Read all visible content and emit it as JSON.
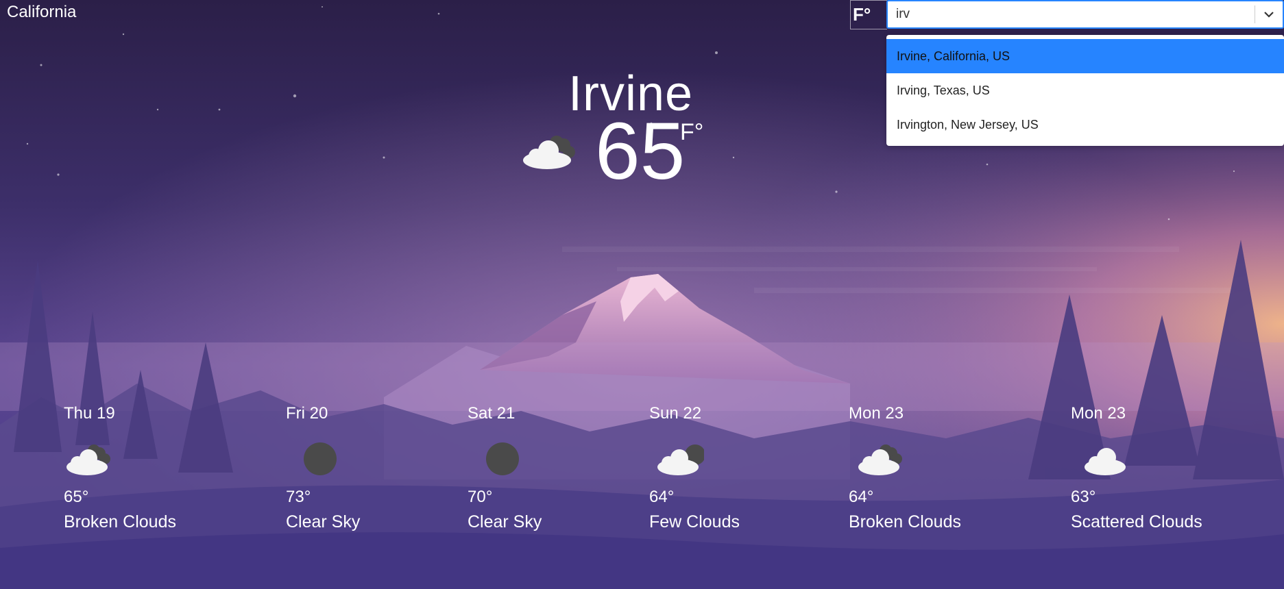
{
  "header": {
    "location": "California"
  },
  "unit_toggle": {
    "label": "F°"
  },
  "search": {
    "value": "irv",
    "options": [
      {
        "label": "Irvine, California, US",
        "selected": true
      },
      {
        "label": "Irving, Texas, US",
        "selected": false
      },
      {
        "label": "Irvington, New Jersey, US",
        "selected": false
      }
    ]
  },
  "current": {
    "city": "Irvine",
    "temperature": "65",
    "unit": "F°",
    "icon": "broken-clouds-icon"
  },
  "forecast": [
    {
      "day": "Thu 19",
      "temp": "65°",
      "desc": "Broken Clouds",
      "icon": "broken-clouds-icon"
    },
    {
      "day": "Fri 20",
      "temp": "73°",
      "desc": "Clear Sky",
      "icon": "clear-sky-night-icon"
    },
    {
      "day": "Sat 21",
      "temp": "70°",
      "desc": "Clear Sky",
      "icon": "clear-sky-night-icon"
    },
    {
      "day": "Sun 22",
      "temp": "64°",
      "desc": "Few Clouds",
      "icon": "few-clouds-icon"
    },
    {
      "day": "Mon 23",
      "temp": "64°",
      "desc": "Broken Clouds",
      "icon": "broken-clouds-icon"
    },
    {
      "day": "Mon 23",
      "temp": "63°",
      "desc": "Scattered Clouds",
      "icon": "scattered-clouds-icon"
    }
  ],
  "colors": {
    "sky_top": "#2b1f48",
    "sky_mid": "#4a3a7c",
    "horizon": "#f0a58a",
    "accent": "#2684ff"
  }
}
